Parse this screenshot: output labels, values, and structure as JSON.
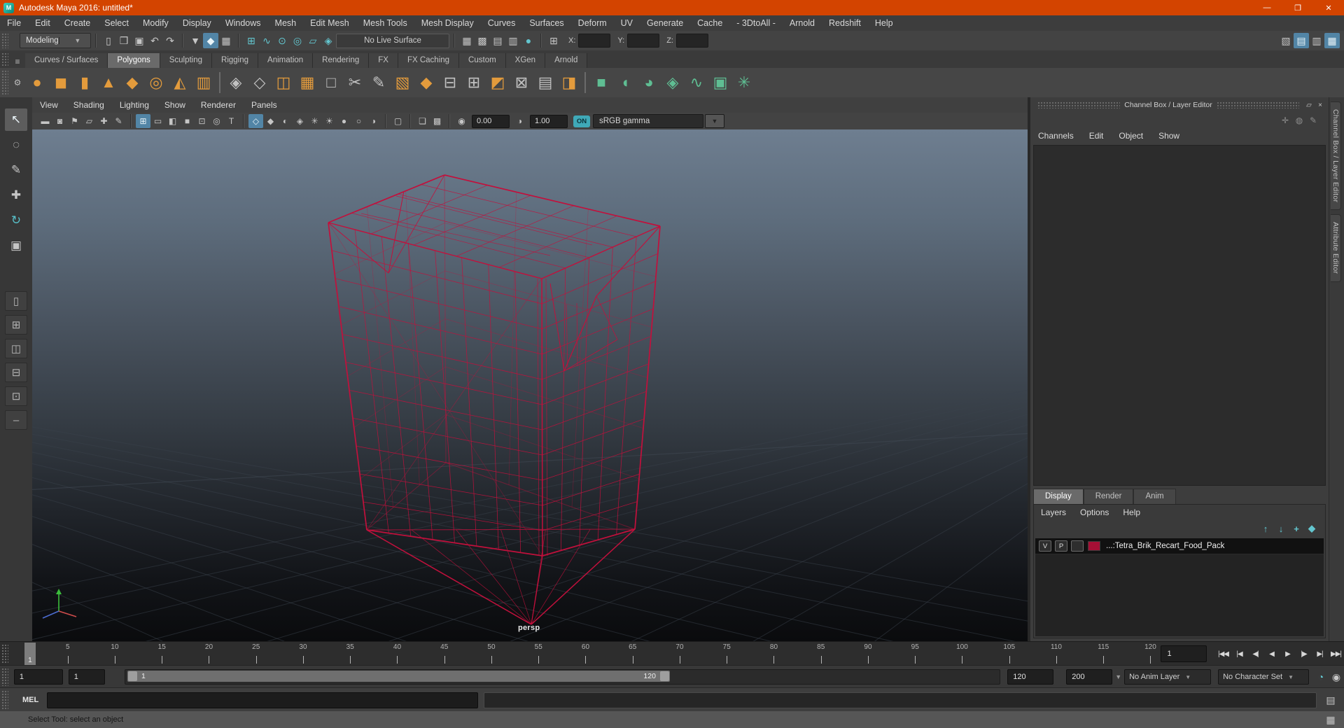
{
  "window": {
    "title": "Autodesk Maya 2016: untitled*",
    "logo_letter": "M",
    "controls": [
      {
        "name": "minimize-button",
        "glyph": "—"
      },
      {
        "name": "restore-button",
        "glyph": "❐"
      },
      {
        "name": "close-button",
        "glyph": "✕"
      }
    ]
  },
  "menubar": [
    "File",
    "Edit",
    "Create",
    "Select",
    "Modify",
    "Display",
    "Windows",
    "Mesh",
    "Edit Mesh",
    "Mesh Tools",
    "Mesh Display",
    "Curves",
    "Surfaces",
    "Deform",
    "UV",
    "Generate",
    "Cache",
    "- 3DtoAll -",
    "Arnold",
    "Redshift",
    "Help"
  ],
  "statusline": {
    "menu_set": "Modeling",
    "live_surface": "No Live Surface",
    "x_label": "X:",
    "y_label": "Y:",
    "z_label": "Z:",
    "x_value": "",
    "y_value": "",
    "z_value": "",
    "file_icons": [
      {
        "name": "new-scene-icon",
        "glyph": "▯"
      },
      {
        "name": "open-scene-icon",
        "glyph": "❒"
      },
      {
        "name": "save-scene-icon",
        "glyph": "▣"
      },
      {
        "name": "undo-icon",
        "glyph": "↶"
      },
      {
        "name": "redo-icon",
        "glyph": "↷"
      }
    ],
    "mask_icons": [
      {
        "name": "select-hierarchy-icon",
        "glyph": "▼"
      },
      {
        "name": "select-object-icon",
        "glyph": "◆",
        "active": true
      },
      {
        "name": "select-component-icon",
        "glyph": "▦"
      }
    ],
    "snap_icons": [
      {
        "name": "snap-grid-icon",
        "glyph": "⊞",
        "tone": "teal"
      },
      {
        "name": "snap-curve-icon",
        "glyph": "∿",
        "tone": "teal"
      },
      {
        "name": "snap-point-icon",
        "glyph": "⊙",
        "tone": "teal"
      },
      {
        "name": "snap-projected-center-icon",
        "glyph": "◎",
        "tone": "teal"
      },
      {
        "name": "snap-view-plane-icon",
        "glyph": "▱",
        "tone": "teal"
      },
      {
        "name": "make-live-icon",
        "glyph": "◈",
        "tone": "teal"
      }
    ],
    "render_icons": [
      {
        "name": "render-frame-icon",
        "glyph": "▦"
      },
      {
        "name": "ipr-render-icon",
        "glyph": "▩"
      },
      {
        "name": "render-settings-icon",
        "glyph": "▤"
      },
      {
        "name": "hypershade-icon",
        "glyph": "▥"
      },
      {
        "name": "render-view-icon",
        "glyph": "●",
        "tone": "teal"
      }
    ],
    "input_mode_icon": [
      {
        "name": "input-field-mode-icon",
        "glyph": "⊞"
      }
    ],
    "sidebar_toggle_icons": [
      {
        "name": "modeling-toolkit-toggle-icon",
        "glyph": "▧"
      },
      {
        "name": "attribute-editor-toggle-icon",
        "glyph": "▤",
        "active": true
      },
      {
        "name": "tool-settings-toggle-icon",
        "glyph": "▥"
      },
      {
        "name": "channel-box-toggle-icon",
        "glyph": "▦",
        "active": true
      }
    ]
  },
  "shelf": {
    "tabs": [
      "Curves / Surfaces",
      "Polygons",
      "Sculpting",
      "Rigging",
      "Animation",
      "Rendering",
      "FX",
      "FX Caching",
      "Custom",
      "XGen",
      "Arnold"
    ],
    "active_tab": "Polygons",
    "menu_icon": "≡",
    "gear_icon": "⚙",
    "icons": [
      {
        "name": "poly-sphere-icon",
        "glyph": "●",
        "tone": "orange"
      },
      {
        "name": "poly-cube-icon",
        "glyph": "◼",
        "tone": "orange"
      },
      {
        "name": "poly-cylinder-icon",
        "glyph": "▮",
        "tone": "orange"
      },
      {
        "name": "poly-cone-icon",
        "glyph": "▲",
        "tone": "orange"
      },
      {
        "name": "poly-plane-icon",
        "glyph": "◆",
        "tone": "orange"
      },
      {
        "name": "poly-torus-icon",
        "glyph": "◎",
        "tone": "orange"
      },
      {
        "name": "poly-pyramid-icon",
        "glyph": "◭",
        "tone": "orange"
      },
      {
        "name": "poly-pipe-icon",
        "glyph": "▥",
        "tone": "orange"
      },
      {
        "sep": true
      },
      {
        "name": "combine-icon",
        "glyph": "◈",
        "tone": "gray"
      },
      {
        "name": "separate-icon",
        "glyph": "◇",
        "tone": "gray"
      },
      {
        "name": "mirror-icon",
        "glyph": "◫",
        "tone": "orange"
      },
      {
        "name": "smooth-icon",
        "glyph": "▦",
        "tone": "orange"
      },
      {
        "name": "boolean-icon",
        "glyph": "□",
        "tone": "gray"
      },
      {
        "name": "multi-cut-icon",
        "glyph": "✂",
        "tone": "gray"
      },
      {
        "name": "crease-tool-icon",
        "glyph": "✎",
        "tone": "gray"
      },
      {
        "name": "extrude-icon",
        "glyph": "▧",
        "tone": "orange"
      },
      {
        "name": "bevel-icon",
        "glyph": "◆",
        "tone": "orange"
      },
      {
        "name": "bridge-icon",
        "glyph": "⊟",
        "tone": "gray"
      },
      {
        "name": "edit-edge-flow-icon",
        "glyph": "⊞",
        "tone": "gray"
      },
      {
        "name": "quad-draw-icon",
        "glyph": "◩",
        "tone": "orange"
      },
      {
        "name": "target-weld-icon",
        "glyph": "⊠",
        "tone": "gray"
      },
      {
        "name": "lattice-icon",
        "glyph": "▤",
        "tone": "gray"
      },
      {
        "name": "symmetry-icon",
        "glyph": "◨",
        "tone": "orange"
      },
      {
        "sep": true
      },
      {
        "name": "sculpt-plane-icon",
        "glyph": "■",
        "tone": "green"
      },
      {
        "name": "sculpt-grab-icon",
        "glyph": "◖",
        "tone": "green"
      },
      {
        "name": "sculpt-smooth-icon",
        "glyph": "◕",
        "tone": "green"
      },
      {
        "name": "sculpt-cube-icon",
        "glyph": "◈",
        "tone": "green"
      },
      {
        "name": "sculpt-wave-icon",
        "glyph": "∿",
        "tone": "green"
      },
      {
        "name": "bake-icon",
        "glyph": "▣",
        "tone": "green"
      },
      {
        "name": "spread-icon",
        "glyph": "✳",
        "tone": "green"
      }
    ]
  },
  "toolbox": {
    "tools": [
      {
        "name": "select-tool-icon",
        "glyph": "↖",
        "active": true
      },
      {
        "name": "lasso-tool-icon",
        "glyph": "◌"
      },
      {
        "name": "paint-select-tool-icon",
        "glyph": "✎"
      },
      {
        "name": "move-tool-icon",
        "glyph": "✚"
      },
      {
        "name": "rotate-tool-icon",
        "glyph": "↻",
        "tone": "teal"
      },
      {
        "name": "scale-tool-icon",
        "glyph": "▣"
      }
    ],
    "layouts": [
      {
        "name": "layout-single-pane-icon",
        "glyph": "▯"
      },
      {
        "name": "layout-four-pane-icon",
        "glyph": "⊞"
      },
      {
        "name": "layout-persp-outliner-icon",
        "glyph": "◫"
      },
      {
        "name": "layout-hypershade-icon",
        "glyph": "⊟"
      },
      {
        "name": "layout-persp-graph-icon",
        "glyph": "⊡"
      },
      {
        "name": "layout-collapse-icon",
        "glyph": "–"
      }
    ]
  },
  "panel": {
    "menus": [
      "View",
      "Shading",
      "Lighting",
      "Show",
      "Renderer",
      "Panels"
    ],
    "toolbar_icons": [
      {
        "name": "select-camera-icon",
        "glyph": "▬"
      },
      {
        "name": "lock-camera-icon",
        "glyph": "◙"
      },
      {
        "name": "camera-bookmark-icon",
        "glyph": "⚑"
      },
      {
        "name": "image-plane-icon",
        "glyph": "▱"
      },
      {
        "name": "pan-zoom-icon",
        "glyph": "✚"
      },
      {
        "name": "grease-pencil-icon",
        "glyph": "✎"
      },
      {
        "sep": true
      },
      {
        "name": "grid-toggle-icon",
        "glyph": "⊞",
        "active": true
      },
      {
        "name": "film-gate-icon",
        "glyph": "▭"
      },
      {
        "name": "resolution-gate-icon",
        "glyph": "◧"
      },
      {
        "name": "gate-mask-icon",
        "glyph": "■"
      },
      {
        "name": "field-chart-icon",
        "glyph": "⊡"
      },
      {
        "name": "safe-action-icon",
        "glyph": "◎"
      },
      {
        "name": "safe-title-icon",
        "glyph": "T"
      },
      {
        "sep": true
      },
      {
        "name": "wireframe-display-icon",
        "glyph": "◇",
        "active": true
      },
      {
        "name": "smooth-shade-icon",
        "glyph": "◆"
      },
      {
        "name": "textured-display-icon",
        "glyph": "◐"
      },
      {
        "name": "use-default-material-icon",
        "glyph": "◈"
      },
      {
        "name": "xray-display-icon",
        "glyph": "✳"
      },
      {
        "name": "lighting-toggle-icon",
        "glyph": "☀"
      },
      {
        "name": "shadows-toggle-icon",
        "glyph": "●"
      },
      {
        "name": "occlusion-toggle-icon",
        "glyph": "○"
      },
      {
        "name": "motion-blur-toggle-icon",
        "glyph": "◑"
      },
      {
        "sep": true
      },
      {
        "name": "isolate-select-icon",
        "glyph": "▢"
      },
      {
        "sep": true
      },
      {
        "name": "snapshot-icon",
        "glyph": "❏"
      },
      {
        "name": "multi-pass-icon",
        "glyph": "▩"
      },
      {
        "sep": true
      },
      {
        "name": "exposure-icon",
        "glyph": "◉"
      }
    ],
    "contrast_icon": "◑",
    "exposure": "0.00",
    "gamma": "1.00",
    "on_label": "ON",
    "view_transform": "sRGB gamma"
  },
  "viewport": {
    "camera_label": "persp"
  },
  "channel_box": {
    "title": "Channel Box / Layer Editor",
    "header_icons": [
      {
        "name": "popout-panel-icon",
        "glyph": "▱"
      },
      {
        "name": "close-panel-icon",
        "glyph": "×"
      }
    ],
    "axis_icons": [
      {
        "name": "manipulator-axis-icon",
        "glyph": "✛",
        "tone": "teal"
      },
      {
        "name": "speed-control-icon",
        "glyph": "◍"
      },
      {
        "name": "pencil-icon",
        "glyph": "✎"
      }
    ],
    "menus": [
      "Channels",
      "Edit",
      "Object",
      "Show"
    ],
    "side_tabs": [
      "Channel Box / Layer Editor",
      "Attribute Editor"
    ]
  },
  "layer_editor": {
    "tabs": [
      "Display",
      "Render",
      "Anim"
    ],
    "active_tab": "Display",
    "menus": [
      "Layers",
      "Options",
      "Help"
    ],
    "tool_icons": [
      {
        "name": "move-layer-up-icon",
        "glyph": "↑",
        "tone": "teal"
      },
      {
        "name": "move-layer-down-icon",
        "glyph": "↓",
        "tone": "teal"
      },
      {
        "name": "add-selected-to-layer-icon",
        "glyph": "+",
        "tone": "teal"
      },
      {
        "name": "create-empty-layer-icon",
        "glyph": "◆",
        "tone": "teal"
      }
    ],
    "layers": [
      {
        "visible": "V",
        "playback": "P",
        "name": "...:Tetra_Brik_Recart_Food_Pack",
        "swatch_color": "#a50f35"
      }
    ]
  },
  "timeline": {
    "ticks": [
      5,
      10,
      15,
      20,
      25,
      30,
      35,
      40,
      45,
      50,
      55,
      60,
      65,
      70,
      75,
      80,
      85,
      90,
      95,
      100,
      105,
      110,
      115,
      120
    ],
    "current_frame": "1",
    "frame_field": "1",
    "playback_icons": [
      {
        "name": "go-to-start-button",
        "glyph": "|◀◀"
      },
      {
        "name": "step-back-key-button",
        "glyph": "|◀"
      },
      {
        "name": "step-back-frame-button",
        "glyph": "◀|"
      },
      {
        "name": "play-backwards-button",
        "glyph": "◀"
      },
      {
        "name": "play-forwards-button",
        "glyph": "▶"
      },
      {
        "name": "step-forward-frame-button",
        "glyph": "|▶"
      },
      {
        "name": "step-forward-key-button",
        "glyph": "▶|"
      },
      {
        "name": "go-to-end-button",
        "glyph": "▶▶|"
      }
    ]
  },
  "range_slider": {
    "playback_start": "1",
    "anim_start": "1",
    "range_start_label": "1",
    "range_end_label": "120",
    "playback_end": "120",
    "anim_end": "200",
    "anim_layer": "No Anim Layer",
    "character_set": "No Character Set",
    "right_icons": [
      {
        "name": "animation-preferences-icon",
        "glyph": "◔",
        "tone": "teal"
      },
      {
        "name": "auto-keyframe-icon",
        "glyph": "◉"
      }
    ]
  },
  "command_line": {
    "label": "MEL",
    "input_value": "",
    "result_value": "",
    "icon": [
      {
        "name": "script-editor-icon",
        "glyph": "▤"
      }
    ]
  },
  "help_line": {
    "text": "Select Tool: select an object",
    "icon": [
      {
        "name": "quick-help-icon",
        "glyph": "▦"
      }
    ]
  },
  "colors": {
    "titlebar": "#d34400",
    "accent_blue": "#5285a6",
    "accent_teal": "#63c6cf",
    "wireframe": "#c2103c",
    "layer_swatch": "#a50f35",
    "shelf_orange": "#e39b3c",
    "shelf_green": "#5fbe93",
    "viewport_top": "#6e7e90",
    "viewport_bottom": "#0a0b0d"
  }
}
